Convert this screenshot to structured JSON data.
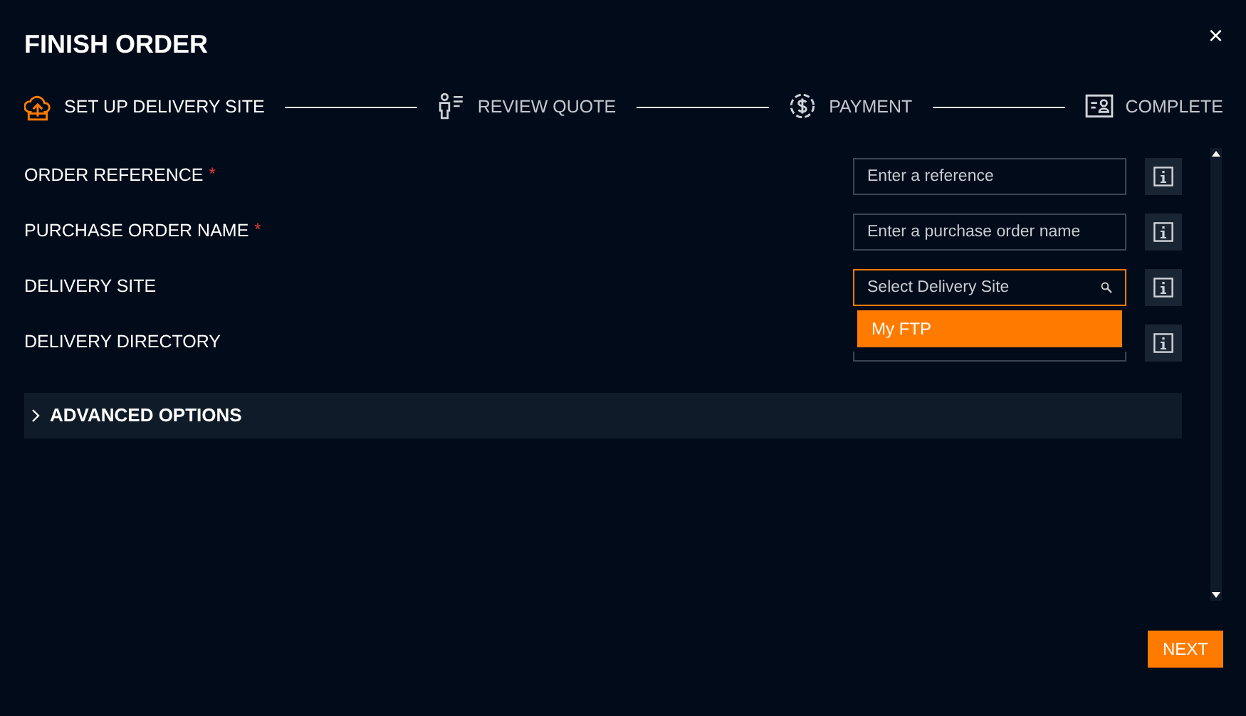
{
  "dialog": {
    "title": "FINISH ORDER",
    "close": "×"
  },
  "steps": [
    {
      "label": "SET UP DELIVERY SITE",
      "selected": true
    },
    {
      "label": "REVIEW QUOTE",
      "selected": false
    },
    {
      "label": "PAYMENT",
      "selected": false
    },
    {
      "label": "COMPLETE",
      "selected": false
    }
  ],
  "fields": [
    {
      "label": "ORDER REFERENCE",
      "required_mark": "*",
      "kind": "text",
      "placeholder": "Enter a reference",
      "focused": false
    },
    {
      "label": "PURCHASE ORDER NAME",
      "required_mark": "*",
      "kind": "text",
      "placeholder": "Enter a purchase order name",
      "focused": false
    },
    {
      "label": "DELIVERY SITE",
      "kind": "search",
      "placeholder": "Select Delivery Site",
      "focused": true,
      "options": [
        {
          "label": "My FTP",
          "selected": true
        }
      ]
    },
    {
      "label": "DELIVERY DIRECTORY",
      "kind": "text",
      "focused": false
    }
  ],
  "advanced": {
    "label": "ADVANCED OPTIONS",
    "expanded": false
  },
  "next_button": "NEXT"
}
